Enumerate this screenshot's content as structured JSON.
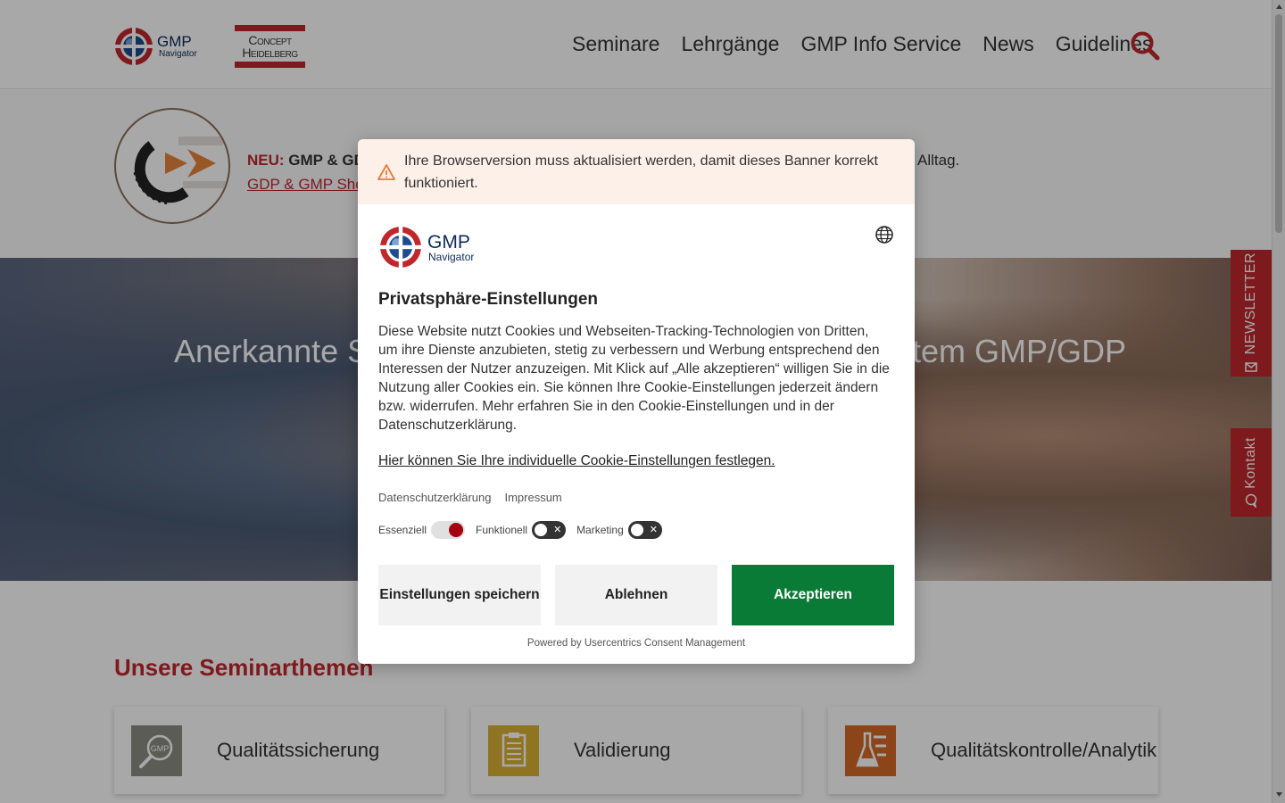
{
  "header": {
    "logo": {
      "line1": "GMP",
      "line2": "Navigator"
    },
    "partner_logo": {
      "line1": "Concept",
      "line2": "Heidelberg"
    },
    "nav": [
      "Seminare",
      "Lehrgänge",
      "GMP Info Service",
      "News",
      "Guidelines"
    ],
    "search_icon": "search-icon"
  },
  "promo": {
    "neu": "NEU:",
    "bold_text": "GMP & GDP",
    "tail_text": "Alltag.",
    "link_text": "GDP & GMP Short"
  },
  "hero": {
    "title_left": "Anerkannte Se",
    "title_right": "tem GMP/GDP"
  },
  "section": {
    "title": "Unsere Seminarthemen",
    "cards": [
      {
        "label": "Qualitätssicherung",
        "icon": "magnifier-gmp-icon",
        "color": "#8c8c84"
      },
      {
        "label": "Validierung",
        "icon": "clipboard-icon",
        "color": "#d9b233"
      },
      {
        "label": "Qualitätskontrolle/Analytik",
        "icon": "flask-icon",
        "color": "#d36a26"
      }
    ]
  },
  "side_tabs": {
    "newsletter": "NEWSLETTER",
    "contact": "Kontakt"
  },
  "consent": {
    "warning": "Ihre Browserversion muss aktualisiert werden, damit dieses Banner korrekt funktioniert.",
    "logo": {
      "line1": "GMP",
      "line2": "Navigator"
    },
    "title": "Privatsphäre-Einstellungen",
    "description": "Diese Website nutzt Cookies und Webseiten-Tracking-Technologien von Dritten, um ihre Dienste anzubieten, stetig zu verbessern und Werbung entsprechend den Interessen der Nutzer anzuzeigen. Mit Klick auf „Alle akzeptieren“ willigen Sie in die Nutzung aller Cookies ein. Sie können Ihre Cookie-Einstellungen jederzeit ändern bzw. widerrufen. Mehr erfahren Sie in den Cookie-Einstellungen und in der Datenschutzerklärung.",
    "settings_link": "Hier können Sie Ihre individuelle Cookie-Einstellungen festlegen.",
    "links": [
      "Datenschutzerklärung",
      "Impressum"
    ],
    "toggles": [
      {
        "label": "Essenziell",
        "state": "on"
      },
      {
        "label": "Funktionell",
        "state": "off"
      },
      {
        "label": "Marketing",
        "state": "off"
      }
    ],
    "buttons": {
      "save": "Einstellungen speichern",
      "deny": "Ablehnen",
      "accept": "Akzeptieren"
    },
    "powered_by": "Powered by Usercentrics Consent Management"
  },
  "colors": {
    "brand_red": "#c0272d",
    "accept_green": "#0a7a37",
    "navy": "#0d2a57"
  }
}
